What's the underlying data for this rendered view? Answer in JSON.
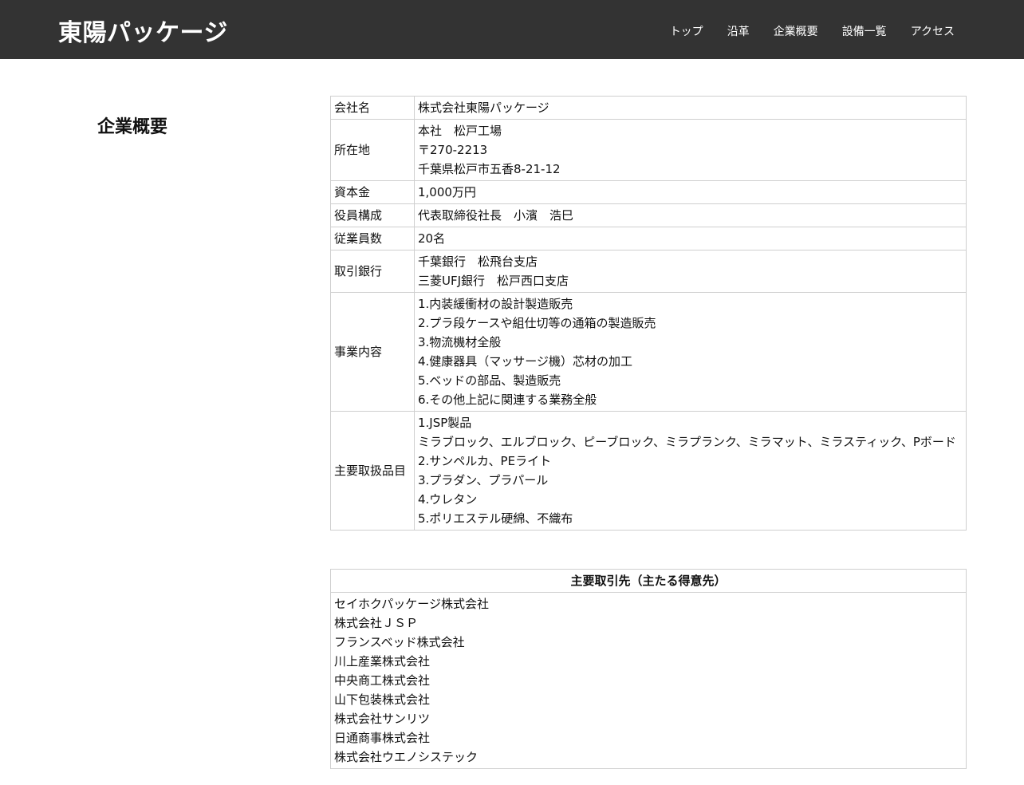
{
  "header": {
    "logo": "東陽パッケージ",
    "nav": [
      "トップ",
      "沿革",
      "企業概要",
      "設備一覧",
      "アクセス"
    ]
  },
  "page": {
    "title": "企業概要"
  },
  "company": [
    {
      "key": "会社名",
      "lines": [
        "株式会社東陽パッケージ"
      ]
    },
    {
      "key": "所在地",
      "lines": [
        "本社　松戸工場",
        "〒270-2213",
        "千葉県松戸市五香8-21-12"
      ]
    },
    {
      "key": "資本金",
      "lines": [
        "1,000万円"
      ]
    },
    {
      "key": "役員構成",
      "lines": [
        "代表取締役社長　小濱　浩巳"
      ]
    },
    {
      "key": "従業員数",
      "lines": [
        "20名"
      ]
    },
    {
      "key": "取引銀行",
      "lines": [
        "千葉銀行　松飛台支店",
        "三菱UFJ銀行　松戸西口支店"
      ]
    },
    {
      "key": "事業内容",
      "lines": [
        "1.内装緩衝材の設計製造販売",
        "2.プラ段ケースや組仕切等の通箱の製造販売",
        "3.物流機材全般",
        "4.健康器具（マッサージ機）芯材の加工",
        "5.ベッドの部品、製造販売",
        "6.その他上記に関連する業務全般"
      ]
    },
    {
      "key": "主要取扱品目",
      "lines": [
        "1.JSP製品",
        "ミラブロック、エルブロック、ピーブロック、ミラプランク、ミラマット、ミラスティック、Pボード",
        "2.サンペルカ、PEライト",
        "3.プラダン、プラパール",
        "4.ウレタン",
        "5.ポリエステル硬綿、不織布"
      ]
    }
  ],
  "clients": {
    "heading": "主要取引先（主たる得意先）",
    "items": [
      "セイホクパッケージ株式会社",
      "株式会社ＪＳＰ",
      "フランスベッド株式会社",
      "川上産業株式会社",
      "中央商工株式会社",
      "山下包装株式会社",
      "株式会社サンリツ",
      "日通商事株式会社",
      "株式会社ウエノシステック"
    ]
  }
}
